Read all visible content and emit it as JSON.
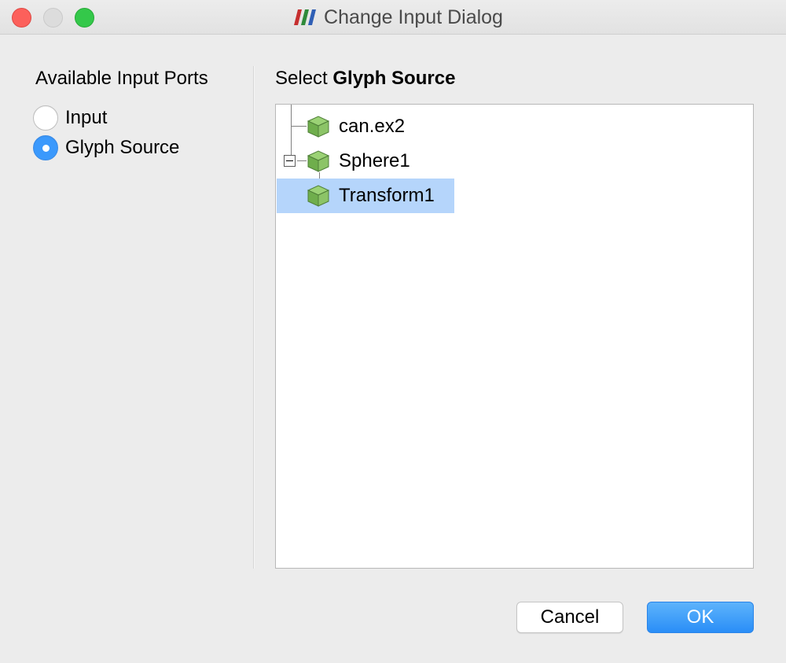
{
  "window": {
    "title": "Change Input Dialog",
    "traffic_lights": {
      "close_color": "#fc605b",
      "minimize_color": "#dcdcdc",
      "maximize_color": "#34c84a"
    },
    "app_icon": "paraview-logo-icon"
  },
  "ports": {
    "label": "Available Input Ports",
    "options": [
      {
        "label": "Input",
        "checked": false
      },
      {
        "label": "Glyph Source",
        "checked": true
      }
    ]
  },
  "source": {
    "label_prefix": "Select",
    "label_bold": "Glyph Source",
    "tree": [
      {
        "label": "can.ex2",
        "icon": "cube-icon",
        "selected": false
      },
      {
        "label": "Sphere1",
        "icon": "cube-icon",
        "expanded": true,
        "selected": false
      },
      {
        "label": "Transform1",
        "icon": "cube-icon",
        "selected": true
      }
    ]
  },
  "buttons": {
    "cancel": "Cancel",
    "ok": "OK"
  },
  "colors": {
    "accent": "#3b99fc",
    "selection": "#b5d5fb",
    "cube_green": "#7cb95a"
  }
}
